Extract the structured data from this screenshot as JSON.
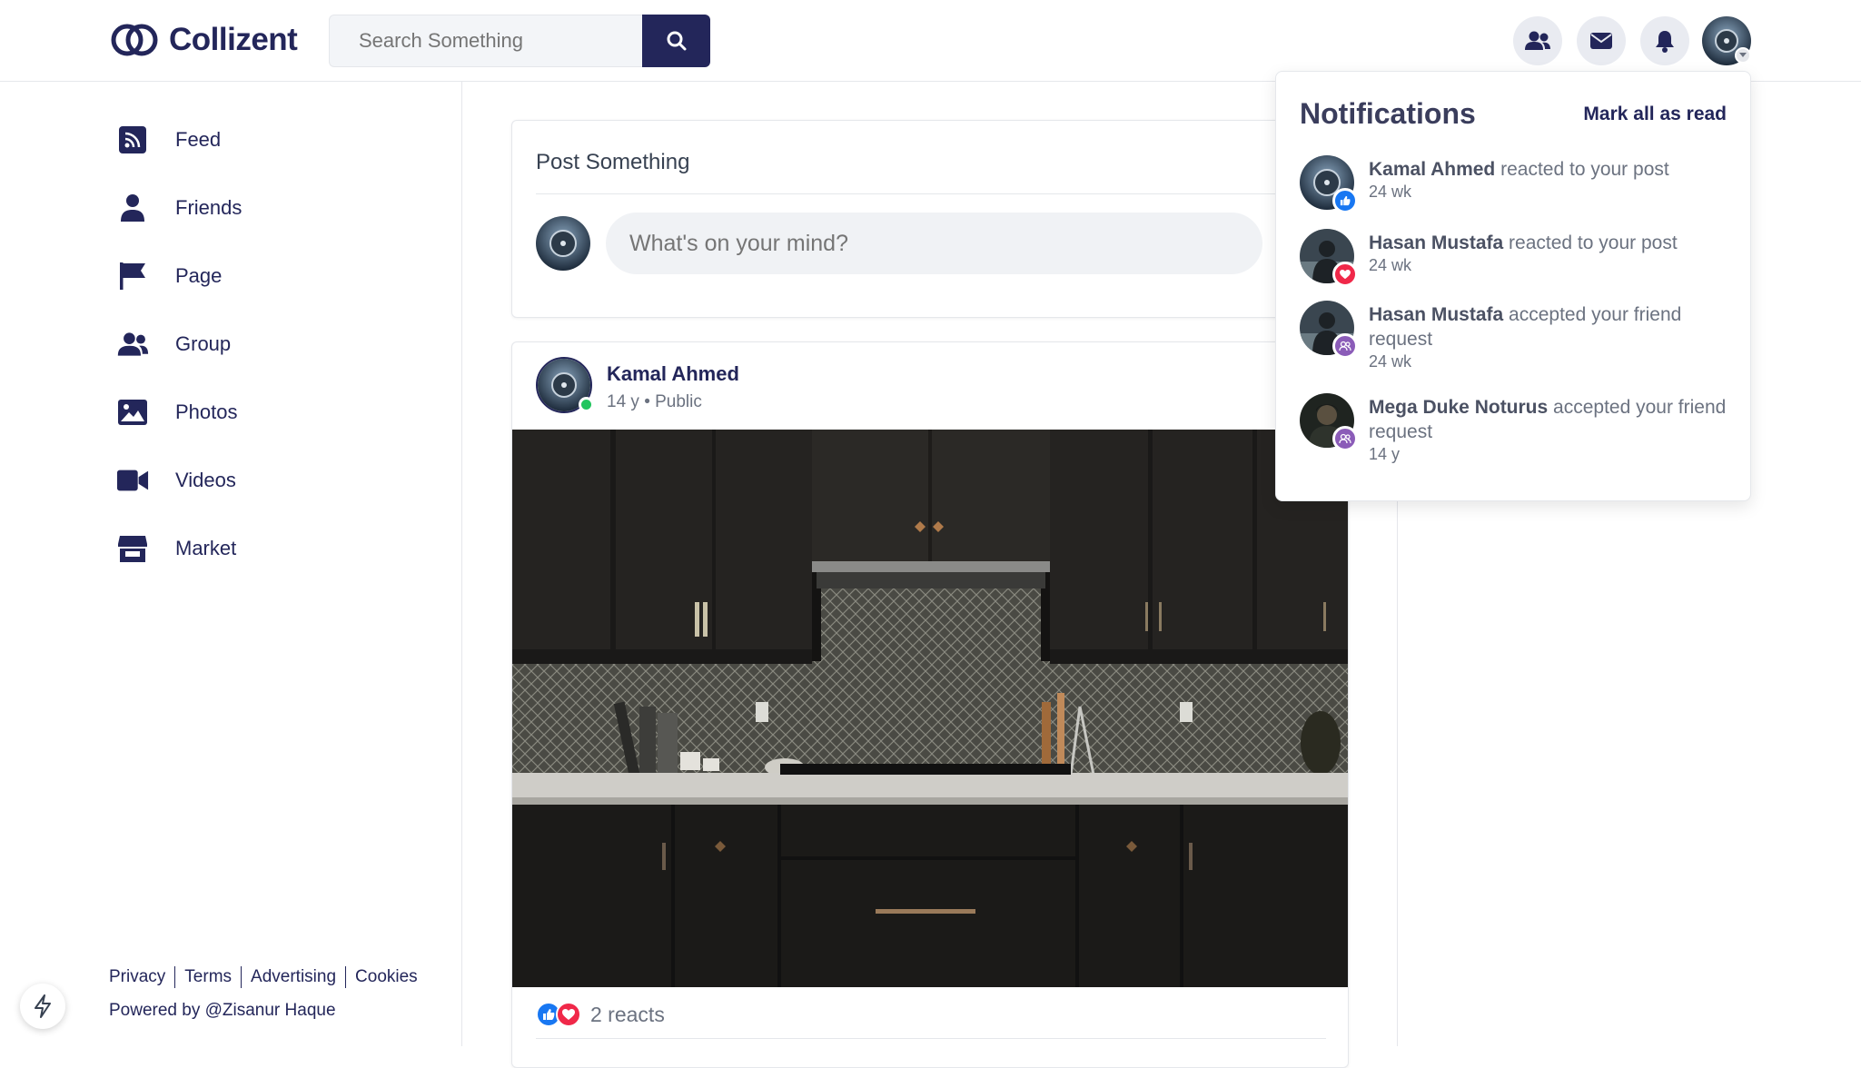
{
  "app": {
    "name": "Collizent"
  },
  "search": {
    "placeholder": "Search Something"
  },
  "sidebar": {
    "items": [
      {
        "label": "Feed",
        "icon": "rss-icon"
      },
      {
        "label": "Friends",
        "icon": "user-icon"
      },
      {
        "label": "Page",
        "icon": "flag-icon"
      },
      {
        "label": "Group",
        "icon": "users-icon"
      },
      {
        "label": "Photos",
        "icon": "image-icon"
      },
      {
        "label": "Videos",
        "icon": "video-icon"
      },
      {
        "label": "Market",
        "icon": "store-icon"
      }
    ]
  },
  "footer": {
    "links": [
      "Privacy",
      "Terms",
      "Advertising",
      "Cookies"
    ],
    "powered": "Powered by @Zisanur Haque"
  },
  "composer": {
    "title": "Post Something",
    "placeholder": "What's on your mind?"
  },
  "post": {
    "author": "Kamal Ahmed",
    "meta": "14 y • Public",
    "reacts": "2 reacts"
  },
  "notifications": {
    "title": "Notifications",
    "mark_all": "Mark all as read",
    "items": [
      {
        "name": "Kamal Ahmed",
        "action": " reacted to your post",
        "time": "24 wk",
        "badge": "like"
      },
      {
        "name": "Hasan Mustafa",
        "action": " reacted to your post",
        "time": "24 wk",
        "badge": "love"
      },
      {
        "name": "Hasan Mustafa",
        "action": " accepted your friend request",
        "time": "24 wk",
        "badge": "friend"
      },
      {
        "name": "Mega Duke Noturus",
        "action": " accepted your friend request",
        "time": "14 y",
        "badge": "friend"
      }
    ]
  },
  "colors": {
    "brand": "#23265a",
    "like": "#1877f2",
    "love": "#f02849",
    "friend": "#8b5cb8",
    "online": "#22c55e"
  }
}
